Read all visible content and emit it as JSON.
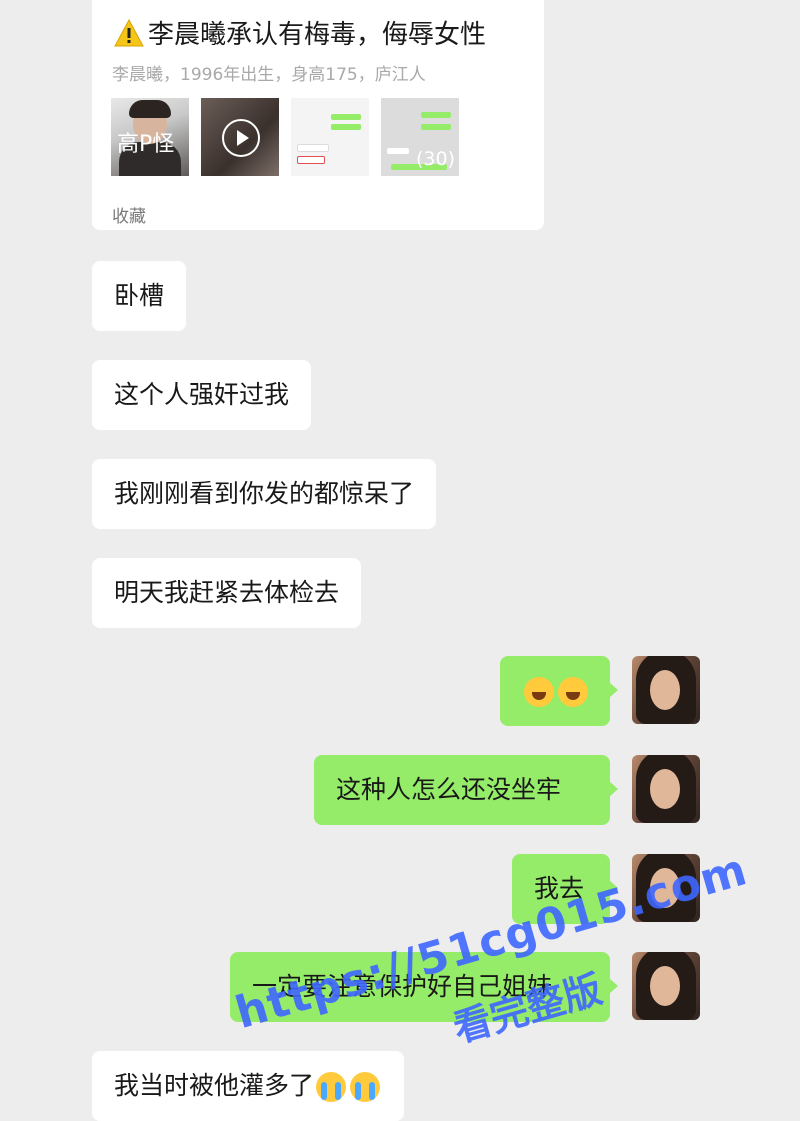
{
  "share_card": {
    "title": "李晨曦承认有梅毒，侮辱女性",
    "subtitle": "李晨曦，1996年出生，身高175，庐江人",
    "thumbnail_caption": "高P怪",
    "image_count": "(30)",
    "source_label": "收藏"
  },
  "messages": [
    {
      "side": "in",
      "text": "卧槽"
    },
    {
      "side": "in",
      "text": "这个人强奸过我"
    },
    {
      "side": "in",
      "text": "我刚刚看到你发的都惊呆了"
    },
    {
      "side": "in",
      "text": "明天我赶紧去体检去"
    },
    {
      "side": "out",
      "text": "",
      "emojis": [
        "laughing-crying-emoji",
        "laughing-crying-emoji"
      ]
    },
    {
      "side": "out",
      "text": "这种人怎么还没坐牢"
    },
    {
      "side": "out",
      "text": "我去"
    },
    {
      "side": "out",
      "text": "一定要注意保护好自己姐妹"
    },
    {
      "side": "in",
      "text": "我当时被他灌多了",
      "emojis": [
        "loudly-crying-emoji",
        "loudly-crying-emoji"
      ]
    }
  ],
  "watermark": {
    "url": "https://51cg015.com",
    "label": "看完整版"
  },
  "colors": {
    "background": "#ededed",
    "incoming_bubble": "#ffffff",
    "outgoing_bubble": "#95ec69",
    "watermark": "#3f67ff"
  }
}
